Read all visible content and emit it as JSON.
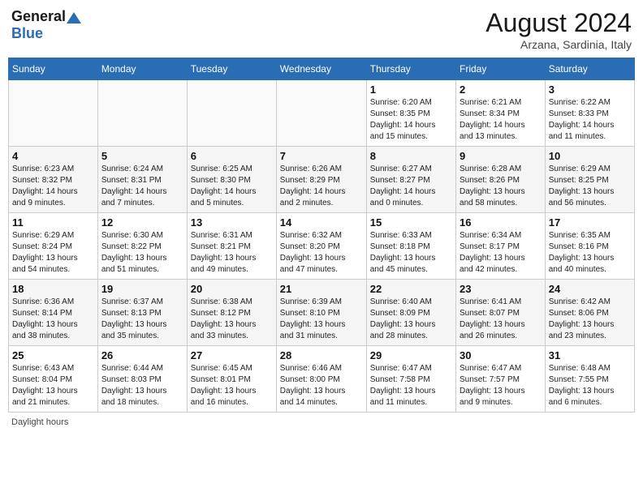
{
  "header": {
    "logo_general": "General",
    "logo_blue": "Blue",
    "month_year": "August 2024",
    "location": "Arzana, Sardinia, Italy"
  },
  "days_of_week": [
    "Sunday",
    "Monday",
    "Tuesday",
    "Wednesday",
    "Thursday",
    "Friday",
    "Saturday"
  ],
  "footer": {
    "note": "Daylight hours"
  },
  "weeks": [
    {
      "days": [
        {
          "num": "",
          "info": ""
        },
        {
          "num": "",
          "info": ""
        },
        {
          "num": "",
          "info": ""
        },
        {
          "num": "",
          "info": ""
        },
        {
          "num": "1",
          "info": "Sunrise: 6:20 AM\nSunset: 8:35 PM\nDaylight: 14 hours\nand 15 minutes."
        },
        {
          "num": "2",
          "info": "Sunrise: 6:21 AM\nSunset: 8:34 PM\nDaylight: 14 hours\nand 13 minutes."
        },
        {
          "num": "3",
          "info": "Sunrise: 6:22 AM\nSunset: 8:33 PM\nDaylight: 14 hours\nand 11 minutes."
        }
      ]
    },
    {
      "days": [
        {
          "num": "4",
          "info": "Sunrise: 6:23 AM\nSunset: 8:32 PM\nDaylight: 14 hours\nand 9 minutes."
        },
        {
          "num": "5",
          "info": "Sunrise: 6:24 AM\nSunset: 8:31 PM\nDaylight: 14 hours\nand 7 minutes."
        },
        {
          "num": "6",
          "info": "Sunrise: 6:25 AM\nSunset: 8:30 PM\nDaylight: 14 hours\nand 5 minutes."
        },
        {
          "num": "7",
          "info": "Sunrise: 6:26 AM\nSunset: 8:29 PM\nDaylight: 14 hours\nand 2 minutes."
        },
        {
          "num": "8",
          "info": "Sunrise: 6:27 AM\nSunset: 8:27 PM\nDaylight: 14 hours\nand 0 minutes."
        },
        {
          "num": "9",
          "info": "Sunrise: 6:28 AM\nSunset: 8:26 PM\nDaylight: 13 hours\nand 58 minutes."
        },
        {
          "num": "10",
          "info": "Sunrise: 6:29 AM\nSunset: 8:25 PM\nDaylight: 13 hours\nand 56 minutes."
        }
      ]
    },
    {
      "days": [
        {
          "num": "11",
          "info": "Sunrise: 6:29 AM\nSunset: 8:24 PM\nDaylight: 13 hours\nand 54 minutes."
        },
        {
          "num": "12",
          "info": "Sunrise: 6:30 AM\nSunset: 8:22 PM\nDaylight: 13 hours\nand 51 minutes."
        },
        {
          "num": "13",
          "info": "Sunrise: 6:31 AM\nSunset: 8:21 PM\nDaylight: 13 hours\nand 49 minutes."
        },
        {
          "num": "14",
          "info": "Sunrise: 6:32 AM\nSunset: 8:20 PM\nDaylight: 13 hours\nand 47 minutes."
        },
        {
          "num": "15",
          "info": "Sunrise: 6:33 AM\nSunset: 8:18 PM\nDaylight: 13 hours\nand 45 minutes."
        },
        {
          "num": "16",
          "info": "Sunrise: 6:34 AM\nSunset: 8:17 PM\nDaylight: 13 hours\nand 42 minutes."
        },
        {
          "num": "17",
          "info": "Sunrise: 6:35 AM\nSunset: 8:16 PM\nDaylight: 13 hours\nand 40 minutes."
        }
      ]
    },
    {
      "days": [
        {
          "num": "18",
          "info": "Sunrise: 6:36 AM\nSunset: 8:14 PM\nDaylight: 13 hours\nand 38 minutes."
        },
        {
          "num": "19",
          "info": "Sunrise: 6:37 AM\nSunset: 8:13 PM\nDaylight: 13 hours\nand 35 minutes."
        },
        {
          "num": "20",
          "info": "Sunrise: 6:38 AM\nSunset: 8:12 PM\nDaylight: 13 hours\nand 33 minutes."
        },
        {
          "num": "21",
          "info": "Sunrise: 6:39 AM\nSunset: 8:10 PM\nDaylight: 13 hours\nand 31 minutes."
        },
        {
          "num": "22",
          "info": "Sunrise: 6:40 AM\nSunset: 8:09 PM\nDaylight: 13 hours\nand 28 minutes."
        },
        {
          "num": "23",
          "info": "Sunrise: 6:41 AM\nSunset: 8:07 PM\nDaylight: 13 hours\nand 26 minutes."
        },
        {
          "num": "24",
          "info": "Sunrise: 6:42 AM\nSunset: 8:06 PM\nDaylight: 13 hours\nand 23 minutes."
        }
      ]
    },
    {
      "days": [
        {
          "num": "25",
          "info": "Sunrise: 6:43 AM\nSunset: 8:04 PM\nDaylight: 13 hours\nand 21 minutes."
        },
        {
          "num": "26",
          "info": "Sunrise: 6:44 AM\nSunset: 8:03 PM\nDaylight: 13 hours\nand 18 minutes."
        },
        {
          "num": "27",
          "info": "Sunrise: 6:45 AM\nSunset: 8:01 PM\nDaylight: 13 hours\nand 16 minutes."
        },
        {
          "num": "28",
          "info": "Sunrise: 6:46 AM\nSunset: 8:00 PM\nDaylight: 13 hours\nand 14 minutes."
        },
        {
          "num": "29",
          "info": "Sunrise: 6:47 AM\nSunset: 7:58 PM\nDaylight: 13 hours\nand 11 minutes."
        },
        {
          "num": "30",
          "info": "Sunrise: 6:47 AM\nSunset: 7:57 PM\nDaylight: 13 hours\nand 9 minutes."
        },
        {
          "num": "31",
          "info": "Sunrise: 6:48 AM\nSunset: 7:55 PM\nDaylight: 13 hours\nand 6 minutes."
        }
      ]
    }
  ]
}
